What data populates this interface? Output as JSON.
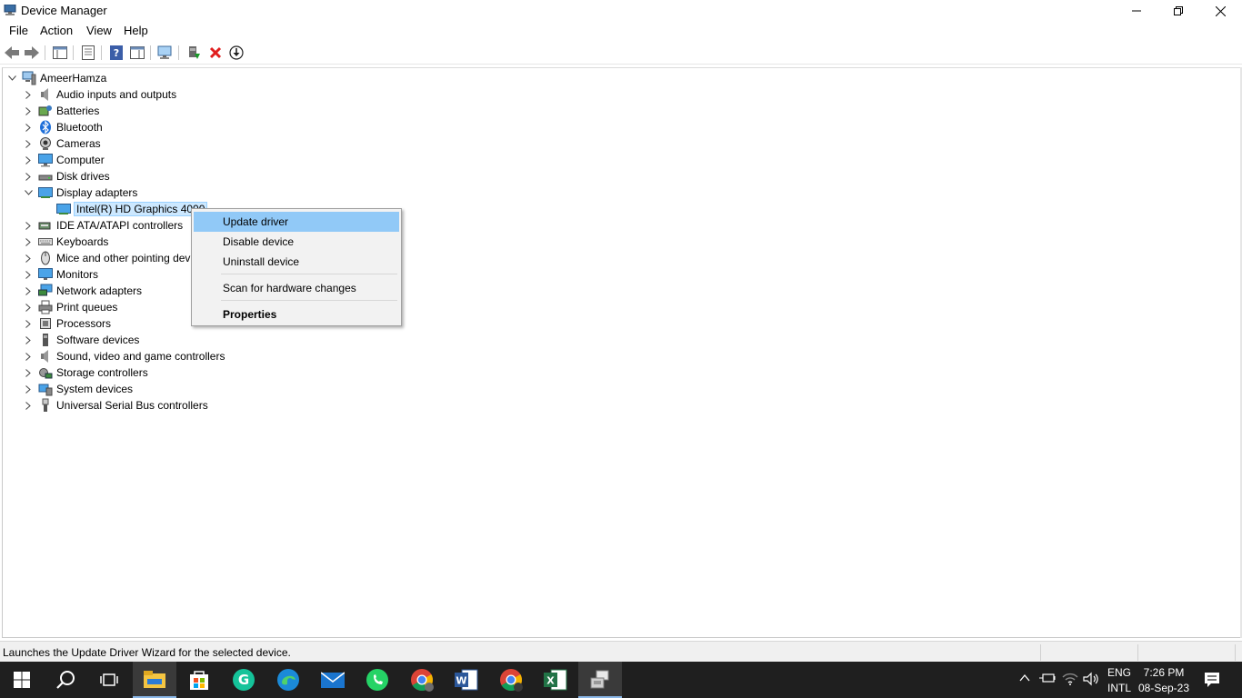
{
  "window": {
    "title": "Device Manager",
    "controls": [
      "minimize",
      "restore",
      "close"
    ]
  },
  "menu": [
    "File",
    "Action",
    "View",
    "Help"
  ],
  "toolbar": {
    "buttons": [
      "back-icon",
      "forward-icon",
      "properties-page-icon",
      "details-icon",
      "help-icon",
      "action-pane-icon",
      "monitor-scan-icon",
      "update-driver-icon",
      "uninstall-x-icon",
      "download-icon"
    ]
  },
  "tree": {
    "root": "AmeerHamza",
    "categories": [
      "Audio inputs and outputs",
      "Batteries",
      "Bluetooth",
      "Cameras",
      "Computer",
      "Disk drives",
      "Display adapters",
      "IDE ATA/ATAPI controllers",
      "Keyboards",
      "Mice and other pointing devices",
      "Monitors",
      "Network adapters",
      "Print queues",
      "Processors",
      "Software devices",
      "Sound, video and game controllers",
      "Storage controllers",
      "System devices",
      "Universal Serial Bus controllers"
    ],
    "expanded_child": "Intel(R) HD Graphics 4000"
  },
  "context_menu": {
    "items": [
      "Update driver",
      "Disable device",
      "Uninstall device",
      "Scan for hardware changes",
      "Properties"
    ]
  },
  "status": "Launches the Update Driver Wizard for the selected device.",
  "taskbar": {
    "language_top": "ENG",
    "language_bottom": "INTL",
    "time": "7:26 PM",
    "date": "08-Sep-23"
  },
  "colors": {
    "selection": "#cce8ff",
    "menu_highlight": "#91c9f7",
    "taskbar": "#1f1f1f",
    "accent": "#0078d7"
  }
}
